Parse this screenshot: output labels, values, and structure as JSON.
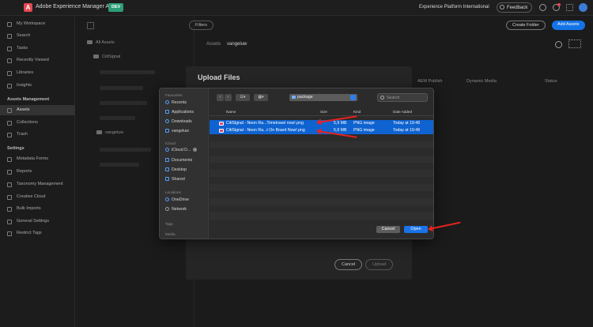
{
  "topbar": {
    "app_title": "Adobe Experience Manager Assets",
    "env_badge": "DEV",
    "org_name": "Experience Platform International",
    "feedback_label": "Feedback"
  },
  "sidebar": {
    "items_top": [
      "My Workspace",
      "Search",
      "Tasks",
      "Recently Viewed",
      "Libraries",
      "Insights"
    ],
    "section_assets": "Assets Management",
    "items_assets": [
      "Assets",
      "Collections",
      "Trash"
    ],
    "section_settings": "Settings",
    "items_settings": [
      "Metadata Forms",
      "Reports",
      "Taxonomy Management",
      "Creative Cloud",
      "Bulk Imports",
      "General Settings",
      "Restrict Tags"
    ]
  },
  "tree": {
    "all_assets": "All Assets",
    "citisignal": "CitiSignal",
    "vangeluw": "vangeluw"
  },
  "main": {
    "filters_label": "Filters",
    "create_folder_label": "Create Folder",
    "add_assets_label": "Add Assets",
    "breadcrumb_root": "Assets",
    "breadcrumb_current": "vangeluw",
    "col_aem": "AEM Publish",
    "col_dm": "Dynamic Media",
    "col_status": "Status"
  },
  "upload_dialog": {
    "title": "Upload Files",
    "cancel_label": "Cancel",
    "upload_label": "Upload"
  },
  "finder": {
    "sections": {
      "favourites": "Favourites",
      "icloud": "iCloud",
      "locations": "Locations",
      "tags": "Tags",
      "media": "Media"
    },
    "favourites": [
      "Recents",
      "Applications",
      "Downloads",
      "vangeluw"
    ],
    "icloud": [
      "iCloud D...",
      "Documents",
      "Desktop",
      "Shared"
    ],
    "locations": [
      "OneDrive",
      "Network"
    ],
    "location": "package",
    "search_placeholder": "Search",
    "columns": {
      "name": "Name",
      "size": "Size",
      "kind": "Kind",
      "date": "Date Added"
    },
    "files": [
      {
        "name": "CitiSignal - Neon Ra...Timetravel now!.png",
        "size": "5,9 MB",
        "kind": "PNG image",
        "date": "Today at 19:48"
      },
      {
        "name": "CitiSignal - Neon Ra...t On Board Now!.png",
        "size": "5,9 MB",
        "kind": "PNG image",
        "date": "Today at 19:48"
      }
    ],
    "cancel_label": "Cancel",
    "open_label": "Open"
  },
  "colors": {
    "accent": "#1473e6",
    "selection": "#0f63d0",
    "annotation_arrow": "#e8231f",
    "brand": "#e34850"
  }
}
